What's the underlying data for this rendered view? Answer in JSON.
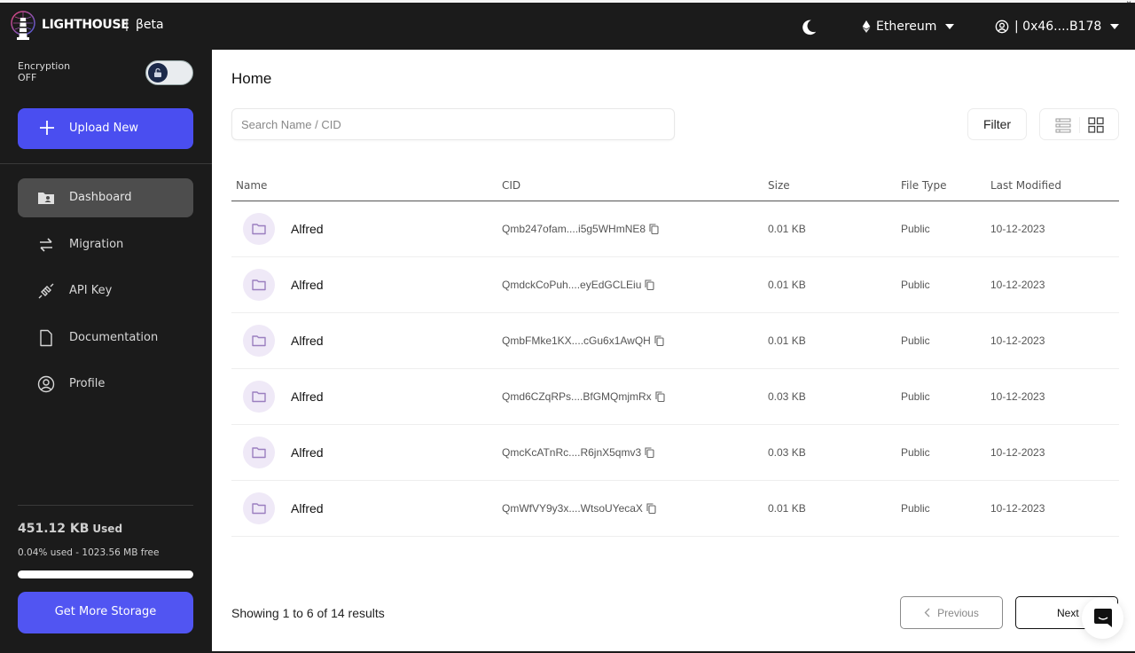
{
  "app": {
    "brand": "LIGHTHOUSE",
    "separator": "|",
    "badge": "βeta"
  },
  "header": {
    "theme_icon": "moon-icon",
    "network": {
      "icon": "ethereum-icon",
      "label": "Ethereum"
    },
    "wallet": {
      "icon": "user-circle-icon",
      "label": "| 0x46....B178"
    },
    "window_close": "×"
  },
  "sidebar": {
    "encryption": {
      "label": "Encryption",
      "state": "OFF",
      "enabled": false
    },
    "upload_button": {
      "icon": "plus-icon",
      "label": "Upload New"
    },
    "nav": [
      {
        "label": "Dashboard",
        "icon": "folder-user-icon",
        "active": true
      },
      {
        "label": "Migration",
        "icon": "arrows-swap-icon",
        "active": false
      },
      {
        "label": "API Key",
        "icon": "plug-icon",
        "active": false
      },
      {
        "label": "Documentation",
        "icon": "document-icon",
        "active": false
      },
      {
        "label": "Profile",
        "icon": "user-circle-icon",
        "active": false
      }
    ],
    "storage": {
      "used": "451.12 KB",
      "used_word": "Used",
      "detail": "0.04% used - 1023.56 MB free",
      "progress_percent": 0.04,
      "bar_color": "#ffffff",
      "button_label": "Get More Storage"
    }
  },
  "main": {
    "title": "Home",
    "search": {
      "placeholder": "Search Name / CID",
      "value": ""
    },
    "filter_label": "Filter",
    "view_modes": [
      "list-view-icon",
      "grid-view-icon"
    ],
    "table": {
      "columns": [
        "Name",
        "CID",
        "Size",
        "File Type",
        "Last Modified"
      ],
      "rows": [
        {
          "name": "Alfred",
          "cid": "Qmb247ofam....i5g5WHmNE8",
          "size": "0.01 KB",
          "type": "Public",
          "modified": "10-12-2023"
        },
        {
          "name": "Alfred",
          "cid": "QmdckCoPuh....eyEdGCLEiu",
          "size": "0.01 KB",
          "type": "Public",
          "modified": "10-12-2023"
        },
        {
          "name": "Alfred",
          "cid": "QmbFMke1KX....cGu6x1AwQH",
          "size": "0.01 KB",
          "type": "Public",
          "modified": "10-12-2023"
        },
        {
          "name": "Alfred",
          "cid": "Qmd6CZqRPs....BfGMQmjmRx",
          "size": "0.03 KB",
          "type": "Public",
          "modified": "10-12-2023"
        },
        {
          "name": "Alfred",
          "cid": "QmcKcATnRc....R6jnX5qmv3",
          "size": "0.03 KB",
          "type": "Public",
          "modified": "10-12-2023"
        },
        {
          "name": "Alfred",
          "cid": "QmWfVY9y3x....WtsoUYecaX",
          "size": "0.01 KB",
          "type": "Public",
          "modified": "10-12-2023"
        }
      ]
    },
    "pagination": {
      "summary": "Showing 1 to 6 of 14 results",
      "previous": "Previous",
      "next": "Next"
    }
  },
  "colors": {
    "accent": "#4a4ef0",
    "sidebar_bg": "#1b1b1b",
    "active_nav": "#4d4d4d",
    "folder_bubble": "#efe9f7",
    "folder_icon": "#9b7fc0"
  }
}
